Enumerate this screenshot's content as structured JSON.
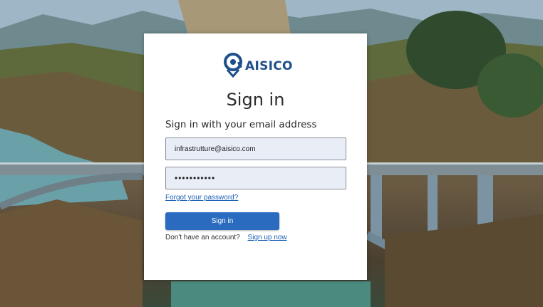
{
  "brand": {
    "logo_text": "AISICO",
    "logo_icon": "location-pin-logo-icon",
    "accent": "#1e4f8a"
  },
  "page": {
    "title": "Sign in",
    "subtitle": "Sign in with your email address"
  },
  "form": {
    "email_value": "infrastrutture@aisico.com",
    "password_value": "•••••••••••",
    "forgot_label": "Forgot your password?",
    "submit_label": "Sign in",
    "no_account_text": "Don't have an account?",
    "signup_label": "Sign up now"
  },
  "colors": {
    "button": "#2a6bbf",
    "link": "#1a5fb4",
    "field_bg": "#e8edf6"
  }
}
